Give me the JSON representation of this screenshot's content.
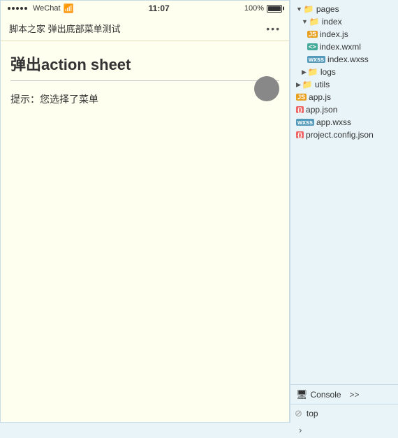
{
  "phone": {
    "status": {
      "signal_dots": 5,
      "app_name": "WeChat",
      "wifi": "◀",
      "time": "11:07",
      "battery_pct": "100%"
    },
    "nav": {
      "title": "脚本之家 弹出底部菜单测试",
      "dots": "•••"
    },
    "main": {
      "heading": "弹出action sheet",
      "hint": "提示：您选择了菜单"
    }
  },
  "file_tree": {
    "items": [
      {
        "indent": 1,
        "type": "folder",
        "arrow": "▼",
        "label": "pages"
      },
      {
        "indent": 2,
        "type": "folder",
        "arrow": "▼",
        "label": "index"
      },
      {
        "indent": 3,
        "type": "js",
        "label": "index.js"
      },
      {
        "indent": 3,
        "type": "xml",
        "label": "index.wxml"
      },
      {
        "indent": 3,
        "type": "wxss",
        "label": "index.wxss"
      },
      {
        "indent": 2,
        "type": "folder",
        "arrow": "▶",
        "label": "logs"
      },
      {
        "indent": 1,
        "type": "folder",
        "arrow": "▶",
        "label": "utils"
      },
      {
        "indent": 1,
        "type": "js",
        "label": "app.js"
      },
      {
        "indent": 1,
        "type": "json",
        "label": "app.json"
      },
      {
        "indent": 1,
        "type": "wxss",
        "label": "app.wxss"
      },
      {
        "indent": 1,
        "type": "json",
        "label": "project.config.json"
      }
    ]
  },
  "console": {
    "tab_label": "Console",
    "input_placeholder": "top",
    "no_entry_symbol": "⊘"
  },
  "colors": {
    "bg": "#fffff0",
    "panel_bg": "#e8f4f8",
    "accent": "#4a9"
  }
}
